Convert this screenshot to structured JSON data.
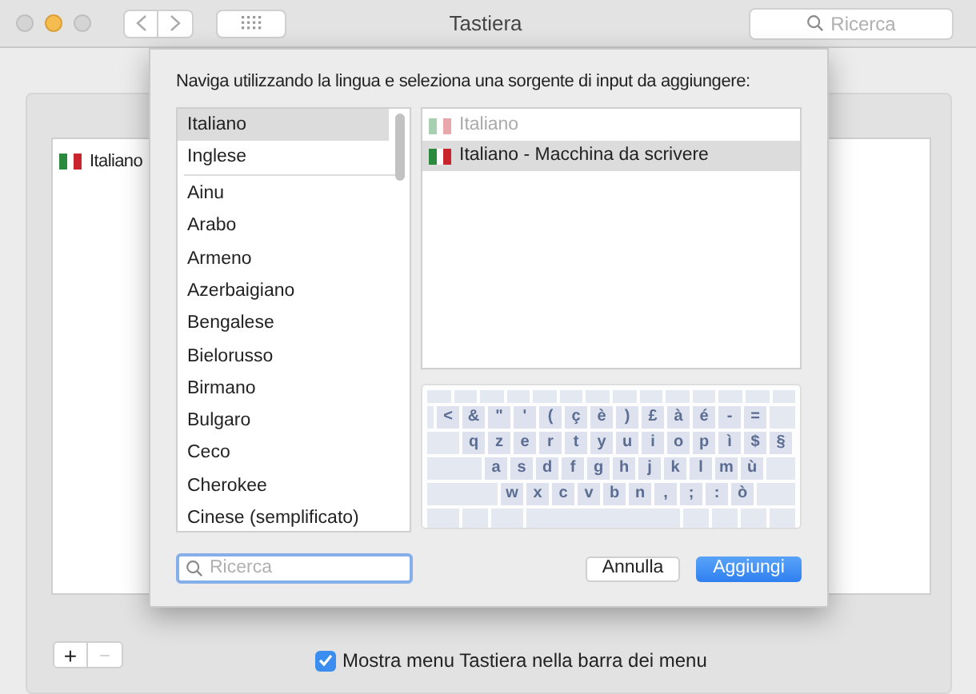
{
  "window": {
    "title": "Tastiera",
    "search_placeholder": "Ricerca"
  },
  "background_list": {
    "items": [
      {
        "label": "Italiano",
        "selected": false
      }
    ]
  },
  "sheet": {
    "prompt": "Naviga utilizzando la lingua e seleziona una sorgente di input da aggiungere:",
    "languages": [
      [
        {
          "label": "Italiano",
          "selected": true
        },
        {
          "label": "Inglese",
          "selected": false
        }
      ],
      [
        {
          "label": "Ainu",
          "selected": false
        },
        {
          "label": "Arabo",
          "selected": false
        },
        {
          "label": "Armeno",
          "selected": false
        },
        {
          "label": "Azerbaigiano",
          "selected": false
        },
        {
          "label": "Bengalese",
          "selected": false
        },
        {
          "label": "Bielorusso",
          "selected": false
        },
        {
          "label": "Birmano",
          "selected": false
        },
        {
          "label": "Bulgaro",
          "selected": false
        },
        {
          "label": "Ceco",
          "selected": false
        },
        {
          "label": "Cherokee",
          "selected": false
        },
        {
          "label": "Cinese (semplificato)",
          "selected": false
        }
      ]
    ],
    "sources": [
      {
        "label": "Italiano",
        "disabled": true,
        "selected": false
      },
      {
        "label": "Italiano - Macchina da scrivere",
        "disabled": false,
        "selected": true
      }
    ],
    "keyboard_rows": [
      [
        "<",
        "&",
        "\"",
        "'",
        "(",
        "ç",
        "è",
        ")",
        "£",
        "à",
        "é",
        "-",
        "="
      ],
      [
        "q",
        "z",
        "e",
        "r",
        "t",
        "y",
        "u",
        "i",
        "o",
        "p",
        "ì",
        "$",
        "§"
      ],
      [
        "a",
        "s",
        "d",
        "f",
        "g",
        "h",
        "j",
        "k",
        "l",
        "m",
        "ù"
      ],
      [
        "w",
        "x",
        "c",
        "v",
        "b",
        "n",
        ",",
        ";",
        ":",
        "ò"
      ]
    ],
    "search_placeholder": "Ricerca",
    "buttons": [
      {
        "label": "Annulla",
        "kind": "secondary"
      },
      {
        "label": "Aggiungi",
        "kind": "primary"
      }
    ]
  },
  "bottom": {
    "add": "+",
    "remove": "−",
    "checkbox": {
      "label": "Mostra menu Tastiera nella barra dei menu",
      "checked": true
    }
  }
}
